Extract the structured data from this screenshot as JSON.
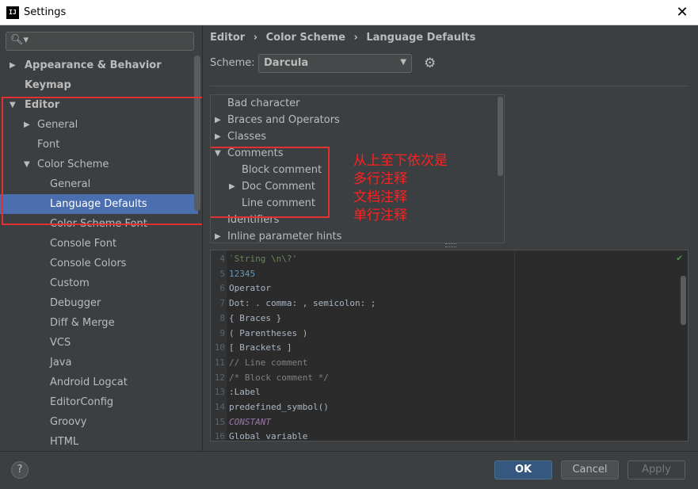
{
  "window": {
    "title": "Settings",
    "app_icon_text": "IJ"
  },
  "sidebar": {
    "search_placeholder": "",
    "items": [
      {
        "label": "Appearance & Behavior",
        "level": 0,
        "arrow": "▶",
        "bold": true
      },
      {
        "label": "Keymap",
        "level": 0,
        "arrow": "",
        "bold": true
      },
      {
        "label": "Editor",
        "level": 0,
        "arrow": "▼",
        "bold": true
      },
      {
        "label": "General",
        "level": 1,
        "arrow": "▶"
      },
      {
        "label": "Font",
        "level": 1,
        "arrow": ""
      },
      {
        "label": "Color Scheme",
        "level": 1,
        "arrow": "▼"
      },
      {
        "label": "General",
        "level": 2,
        "arrow": ""
      },
      {
        "label": "Language Defaults",
        "level": 2,
        "arrow": "",
        "selected": true
      },
      {
        "label": "Color Scheme Font",
        "level": 2,
        "arrow": ""
      },
      {
        "label": "Console Font",
        "level": 2,
        "arrow": ""
      },
      {
        "label": "Console Colors",
        "level": 2,
        "arrow": ""
      },
      {
        "label": "Custom",
        "level": 2,
        "arrow": ""
      },
      {
        "label": "Debugger",
        "level": 2,
        "arrow": ""
      },
      {
        "label": "Diff & Merge",
        "level": 2,
        "arrow": ""
      },
      {
        "label": "VCS",
        "level": 2,
        "arrow": ""
      },
      {
        "label": "Java",
        "level": 2,
        "arrow": ""
      },
      {
        "label": "Android Logcat",
        "level": 2,
        "arrow": ""
      },
      {
        "label": "EditorConfig",
        "level": 2,
        "arrow": ""
      },
      {
        "label": "Groovy",
        "level": 2,
        "arrow": ""
      },
      {
        "label": "HTML",
        "level": 2,
        "arrow": ""
      }
    ]
  },
  "breadcrumb": {
    "part1": "Editor",
    "sep": "›",
    "part2": "Color Scheme",
    "part3": "Language Defaults"
  },
  "scheme": {
    "label": "Scheme:",
    "value": "Darcula"
  },
  "categories": [
    {
      "label": "Bad character",
      "level": 0,
      "arrow": ""
    },
    {
      "label": "Braces and Operators",
      "level": 0,
      "arrow": "▶"
    },
    {
      "label": "Classes",
      "level": 0,
      "arrow": "▶"
    },
    {
      "label": "Comments",
      "level": 0,
      "arrow": "▼"
    },
    {
      "label": "Block comment",
      "level": 1,
      "arrow": ""
    },
    {
      "label": "Doc Comment",
      "level": 1,
      "arrow": "▶"
    },
    {
      "label": "Line comment",
      "level": 1,
      "arrow": ""
    },
    {
      "label": "Identifiers",
      "level": 0,
      "arrow": ""
    },
    {
      "label": "Inline parameter hints",
      "level": 0,
      "arrow": "▶"
    }
  ],
  "annotation": {
    "line1": "从上至下依次是",
    "line2": "多行注释",
    "line3": "文档注释",
    "line4": "单行注释"
  },
  "preview": {
    "lines": [
      {
        "n": "4",
        "text": "`String \\n\\?'",
        "color": "#6a8759"
      },
      {
        "n": "5",
        "text": "12345",
        "color": "#6897bb"
      },
      {
        "n": "6",
        "text": "Operator",
        "color": "#a9b7c6"
      },
      {
        "n": "7",
        "text": "Dot: . comma: , semicolon: ;",
        "color": "#a9b7c6"
      },
      {
        "n": "8",
        "text": "{ Braces }",
        "color": "#a9b7c6"
      },
      {
        "n": "9",
        "text": "( Parentheses )",
        "color": "#a9b7c6"
      },
      {
        "n": "10",
        "text": "[ Brackets ]",
        "color": "#a9b7c6"
      },
      {
        "n": "11",
        "text": "// Line comment",
        "color": "#808080"
      },
      {
        "n": "12",
        "text": "/* Block comment */",
        "color": "#808080"
      },
      {
        "n": "13",
        "text": ":Label",
        "color": "#a9b7c6"
      },
      {
        "n": "14",
        "text": "predefined_symbol()",
        "color": "#a9b7c6"
      },
      {
        "n": "15",
        "text": "CONSTANT",
        "color": "#9876aa"
      },
      {
        "n": "16",
        "text": "Global variable",
        "color": "#a9b7c6"
      }
    ]
  },
  "footer": {
    "help": "?",
    "ok": "OK",
    "cancel": "Cancel",
    "apply": "Apply"
  },
  "colors": {
    "accent": "#4b6eaf",
    "annotation_red": "#e33030",
    "ok_button": "#365880"
  }
}
